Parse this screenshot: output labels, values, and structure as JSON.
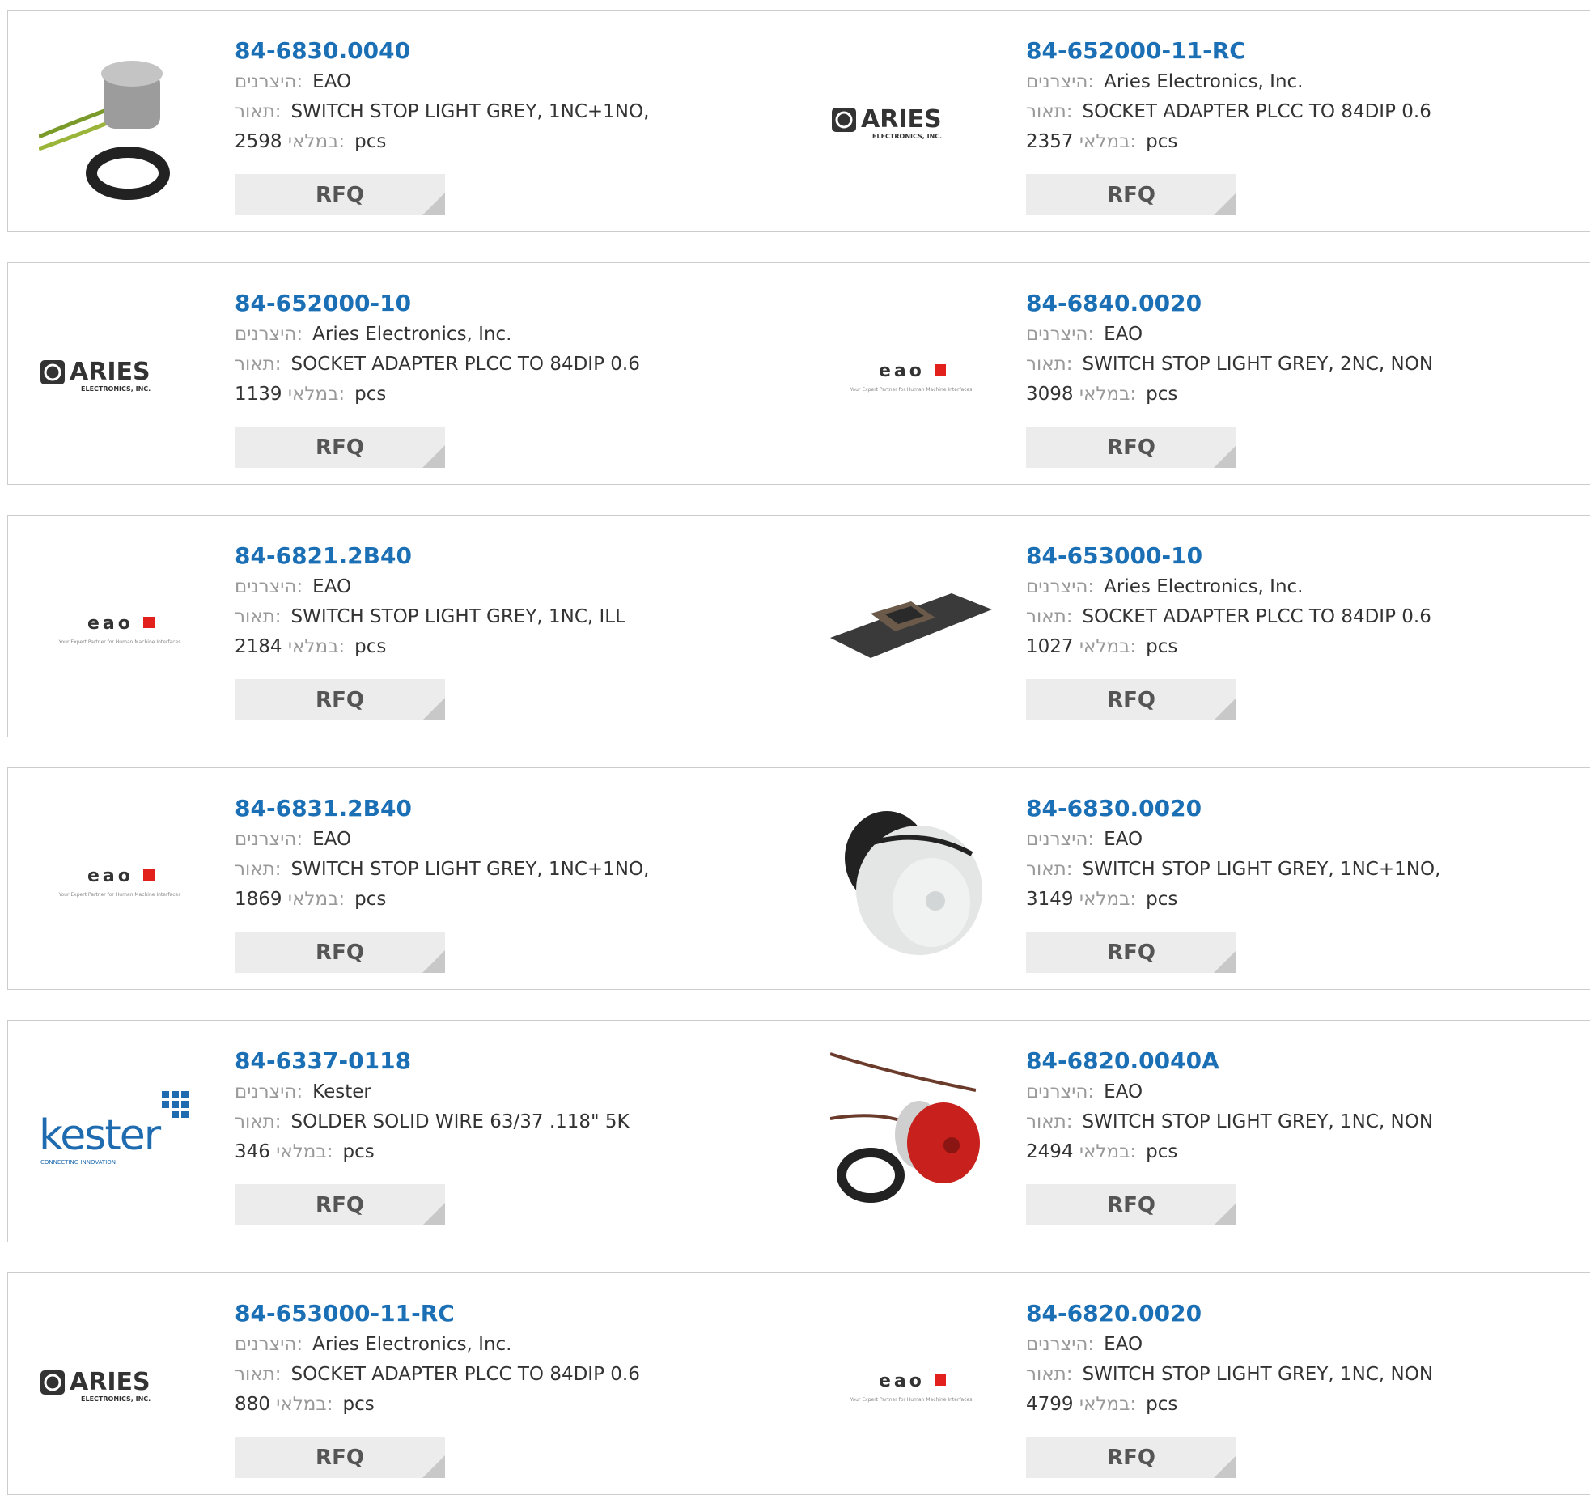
{
  "labels": {
    "manufacturer": "היצרנים:",
    "description": "תאור:",
    "stock": "במלאי:",
    "unit": "pcs",
    "rfq": "RFQ"
  },
  "logos": {
    "aries_name": "ARIES",
    "aries_sub": "ELECTRONICS, INC.",
    "eao_name": "eao",
    "eao_tagline": "Your Expert Partner for Human Machine Interfaces",
    "kester_name": "kester",
    "kester_sub": "CONNECTING INNOVATION"
  },
  "colors": {
    "part_link": "#1b6fb5",
    "eao_red": "#e2211c",
    "kester_blue": "#1e6bb0",
    "button_bg": "#ececec",
    "border": "#cccccc"
  },
  "products": [
    {
      "part": "84-6830.0040",
      "manufacturer": "EAO",
      "description": "SWITCH STOP LIGHT GREY, 1NC+1NO,",
      "stock": "2598",
      "image": "grey-switch-with-wires"
    },
    {
      "part": "84-652000-11-RC",
      "manufacturer": "Aries Electronics, Inc.",
      "description": "SOCKET ADAPTER PLCC TO 84DIP 0.6",
      "stock": "2357",
      "image": "aries-logo"
    },
    {
      "part": "84-652000-10",
      "manufacturer": "Aries Electronics, Inc.",
      "description": "SOCKET ADAPTER PLCC TO 84DIP 0.6",
      "stock": "1139",
      "image": "aries-logo"
    },
    {
      "part": "84-6840.0020",
      "manufacturer": "EAO",
      "description": "SWITCH STOP LIGHT GREY, 2NC, NON",
      "stock": "3098",
      "image": "eao-logo"
    },
    {
      "part": "84-6821.2B40",
      "manufacturer": "EAO",
      "description": "SWITCH STOP LIGHT GREY, 1NC, ILL",
      "stock": "2184",
      "image": "eao-logo"
    },
    {
      "part": "84-653000-10",
      "manufacturer": "Aries Electronics, Inc.",
      "description": "SOCKET ADAPTER PLCC TO 84DIP 0.6",
      "stock": "1027",
      "image": "socket-adapter-board"
    },
    {
      "part": "84-6831.2B40",
      "manufacturer": "EAO",
      "description": "SWITCH STOP LIGHT GREY, 1NC+1NO,",
      "stock": "1869",
      "image": "eao-logo"
    },
    {
      "part": "84-6830.0020",
      "manufacturer": "EAO",
      "description": "SWITCH STOP LIGHT GREY, 1NC+1NO,",
      "stock": "3149",
      "image": "white-stop-switch"
    },
    {
      "part": "84-6337-0118",
      "manufacturer": "Kester",
      "description": "SOLDER SOLID WIRE 63/37 .118\" 5K",
      "stock": "346",
      "image": "kester-logo"
    },
    {
      "part": "84-6820.0040A",
      "manufacturer": "EAO",
      "description": "SWITCH STOP LIGHT GREY, 1NC, NON",
      "stock": "2494",
      "image": "red-stop-switch-with-wires"
    },
    {
      "part": "84-653000-11-RC",
      "manufacturer": "Aries Electronics, Inc.",
      "description": "SOCKET ADAPTER PLCC TO 84DIP 0.6",
      "stock": "880",
      "image": "aries-logo"
    },
    {
      "part": "84-6820.0020",
      "manufacturer": "EAO",
      "description": "SWITCH STOP LIGHT GREY, 1NC, NON",
      "stock": "4799",
      "image": "eao-logo"
    }
  ]
}
